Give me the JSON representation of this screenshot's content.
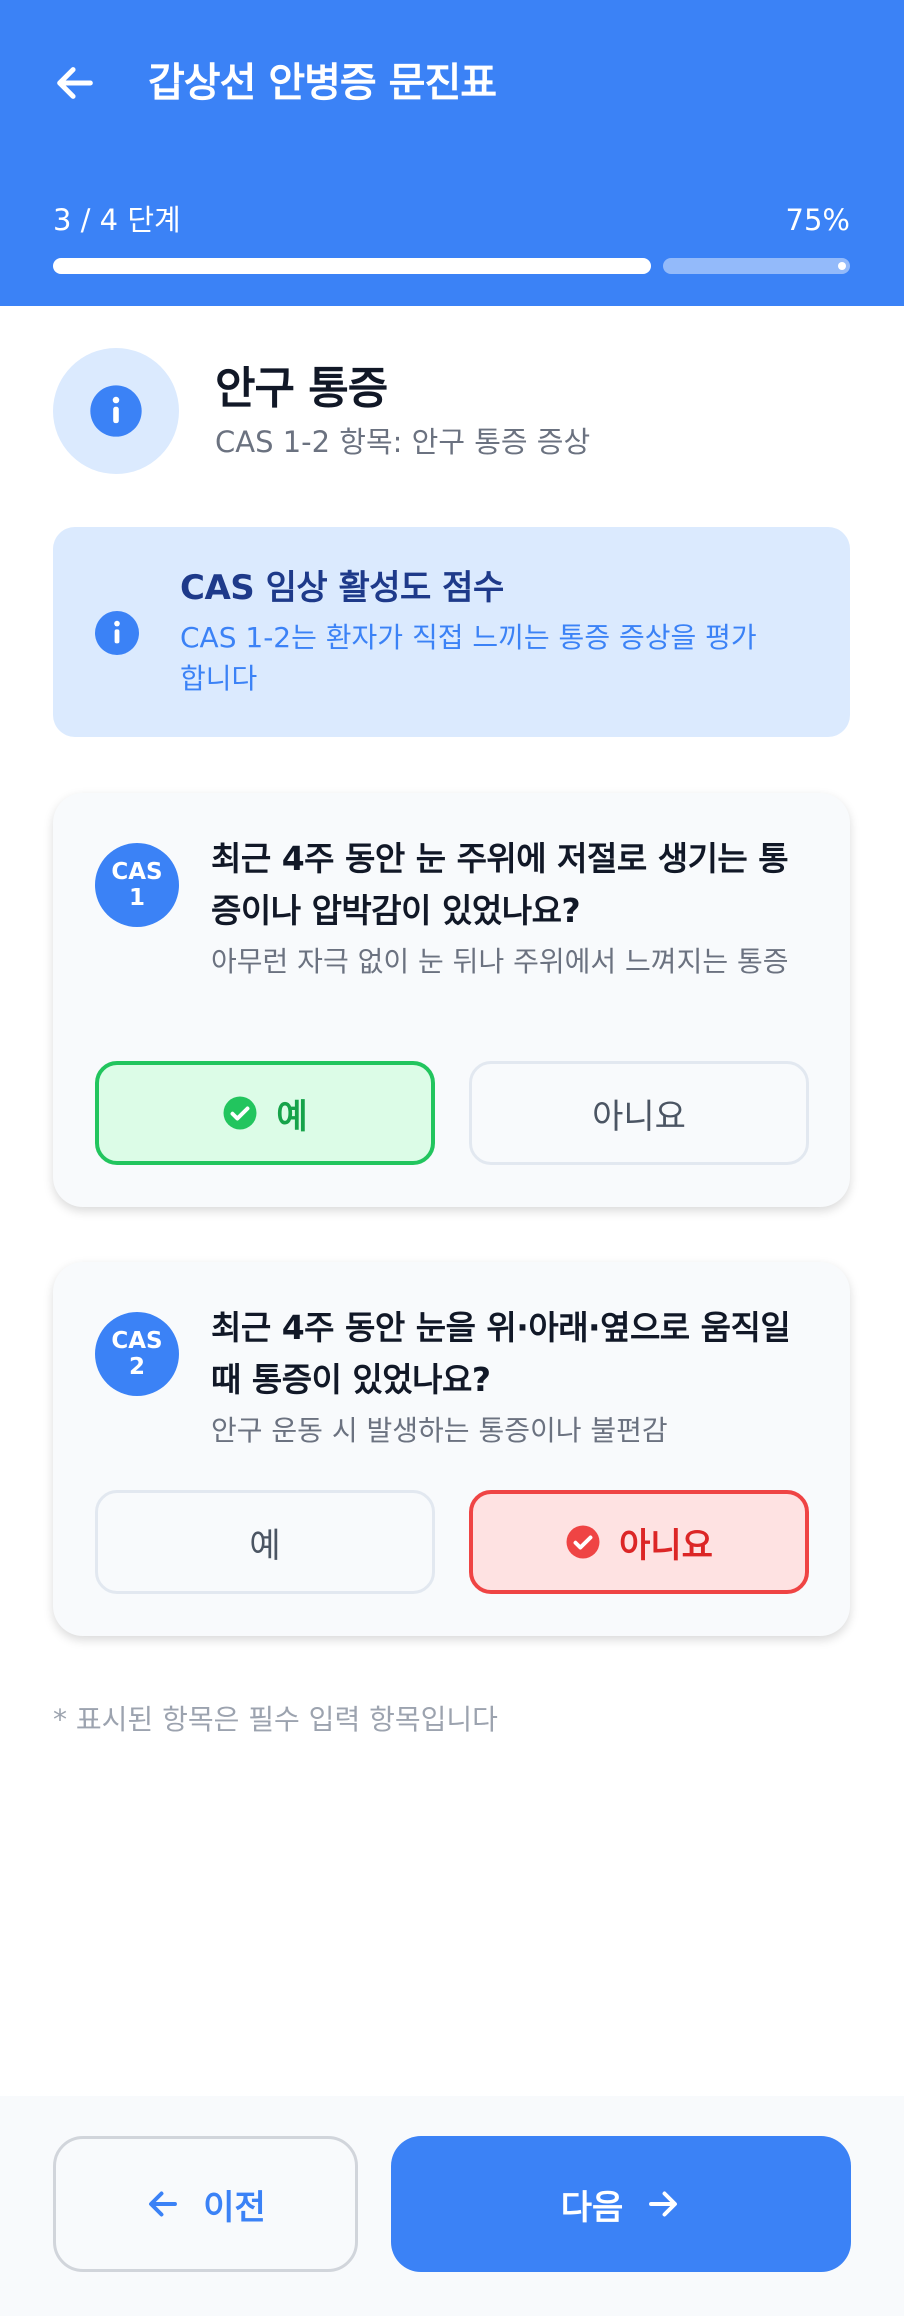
{
  "header": {
    "title": "갑상선 안병증 문진표",
    "back_icon": "arrow-left-icon",
    "step_label": "3 / 4 단계",
    "progress_percent_label": "75%",
    "progress_fraction": 0.75
  },
  "section": {
    "icon": "info-icon",
    "title": "안구 통증",
    "subtitle": "CAS 1-2 항목: 안구 통증 증상"
  },
  "info_box": {
    "icon": "info-icon",
    "title": "CAS 임상 활성도 점수",
    "text": "CAS 1-2는 환자가 직접 느끼는 통증 증상을 평가합니다"
  },
  "questions": [
    {
      "badge_line1": "CAS",
      "badge_line2": "1",
      "question": "최근 4주 동안 눈 주위에 저절로 생기는 통증이나 압박감이 있었나요?",
      "hint": "아무런 자극 없이 눈 뒤나 주위에서 느껴지는 통증",
      "option_yes": "예",
      "option_no": "아니요",
      "selected": "yes"
    },
    {
      "badge_line1": "CAS",
      "badge_line2": "2",
      "question": "최근 4주 동안 눈을 위·아래·옆으로 움직일 때 통증이 있었나요?",
      "hint": "안구 운동 시 발생하는 통증이나 불편감",
      "option_yes": "예",
      "option_no": "아니요",
      "selected": "no"
    }
  ],
  "footnote": "* 표시된 항목은 필수 입력 항목입니다",
  "nav": {
    "prev_label": "이전",
    "next_label": "다음"
  },
  "colors": {
    "primary": "#3b82f6",
    "yes_selected": "#22c55e",
    "no_selected": "#ef4444"
  }
}
